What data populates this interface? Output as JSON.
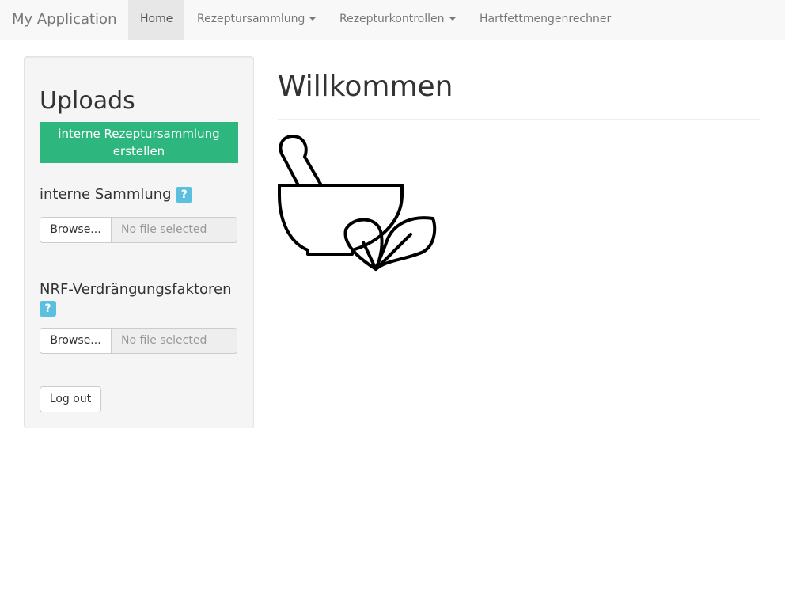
{
  "navbar": {
    "brand": "My Application",
    "items": [
      {
        "label": "Home",
        "active": true,
        "dropdown": false
      },
      {
        "label": "Rezeptursammlung",
        "active": false,
        "dropdown": true
      },
      {
        "label": "Rezepturkontrollen",
        "active": false,
        "dropdown": true
      },
      {
        "label": "Hartfettmengenrechner",
        "active": false,
        "dropdown": false
      }
    ]
  },
  "sidebar": {
    "title": "Uploads",
    "create_button": "interne Rezeptursammlung erstellen",
    "sections": [
      {
        "label": "interne Sammlung",
        "help": "?",
        "browse_label": "Browse...",
        "file_status": "No file selected"
      },
      {
        "label": "NRF-Verdrängungsfaktoren",
        "help": "?",
        "browse_label": "Browse...",
        "file_status": "No file selected"
      }
    ],
    "logout_label": "Log out"
  },
  "main": {
    "title": "Willkommen",
    "logo_icon": "mortar-pestle-herb-icon"
  },
  "colors": {
    "accent_green": "#2db77f",
    "help_blue": "#5bc0de",
    "navbar_bg": "#f8f8f8"
  }
}
